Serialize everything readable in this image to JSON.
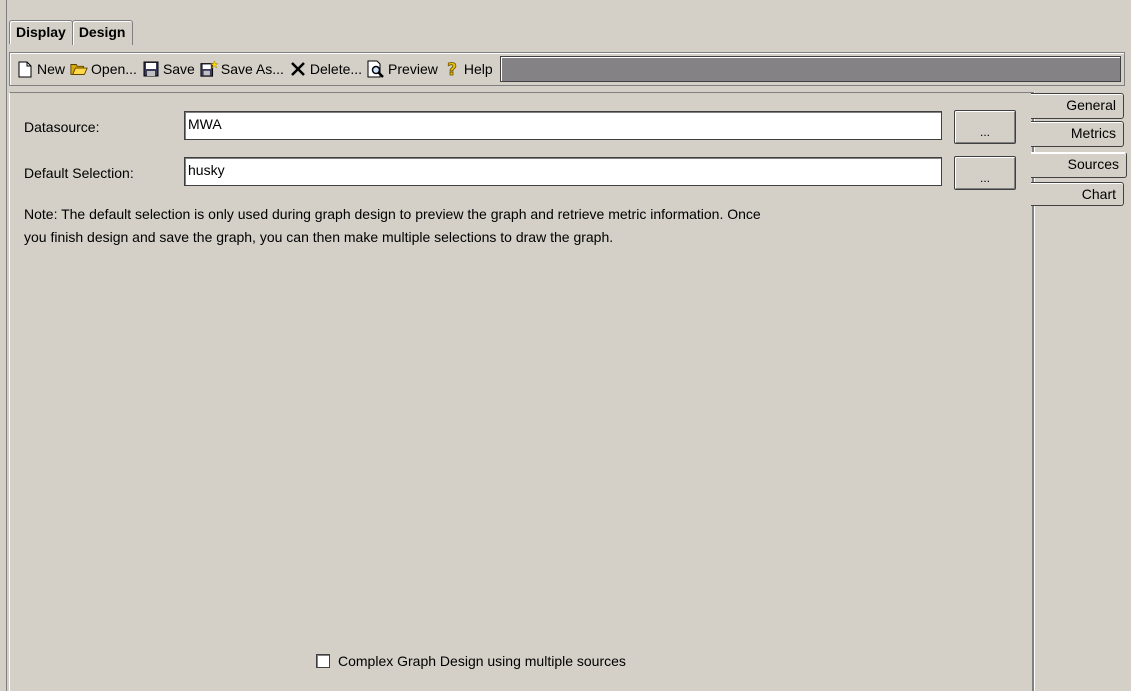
{
  "tabs": [
    {
      "label": "Display"
    },
    {
      "label": "Design"
    }
  ],
  "toolbar": {
    "new": "New",
    "open": "Open...",
    "save": "Save",
    "save_as": "Save As...",
    "delete": "Delete...",
    "preview": "Preview",
    "help": "Help"
  },
  "form": {
    "datasource_label": "Datasource:",
    "datasource_value": "MWA",
    "default_selection_label": "Default Selection:",
    "default_selection_value": "husky",
    "browse_label": "...",
    "note_line1": "Note: The default selection is only used during graph design to preview the graph and retrieve metric information.  Once",
    "note_line2": "you finish design and save the graph, you can then make multiple selections to draw the graph.",
    "complex_checkbox_label": "Complex Graph Design using multiple sources",
    "complex_checked": false
  },
  "side_tabs": [
    {
      "label": "General"
    },
    {
      "label": "Metrics"
    },
    {
      "label": "Sources"
    },
    {
      "label": "Chart"
    }
  ],
  "icons": {
    "new": "document-icon",
    "open": "folder-open-icon",
    "save": "floppy-icon",
    "save_as": "floppy-star-icon",
    "delete": "x-icon",
    "preview": "magnifier-icon",
    "help": "question-icon"
  }
}
